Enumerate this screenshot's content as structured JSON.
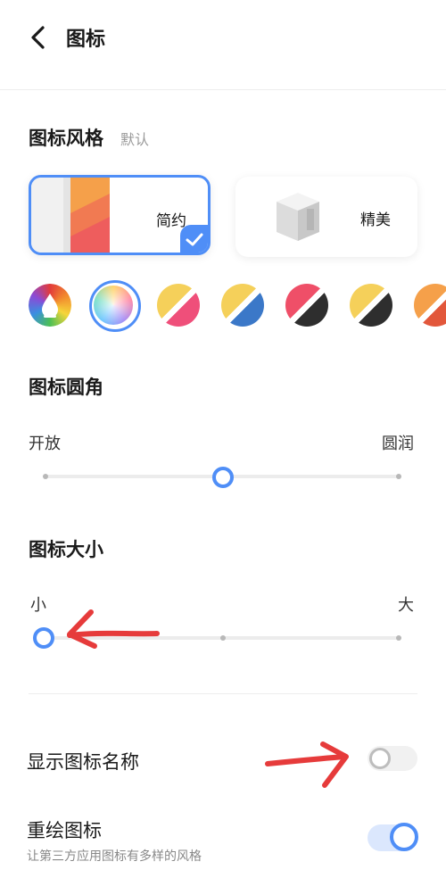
{
  "header": {
    "title": "图标"
  },
  "icon_style": {
    "title": "图标风格",
    "subtitle": "默认",
    "options": [
      {
        "label": "简约",
        "selected": true
      },
      {
        "label": "精美",
        "selected": false
      }
    ]
  },
  "color_themes": {
    "selected_index": 1,
    "swatches": [
      {
        "name": "rainbow-drop"
      },
      {
        "name": "pastel-gradient"
      },
      {
        "name": "pink-yellow"
      },
      {
        "name": "blue-yellow"
      },
      {
        "name": "black-red"
      },
      {
        "name": "black-yellow"
      },
      {
        "name": "orange-red"
      }
    ]
  },
  "corner": {
    "title": "图标圆角",
    "min_label": "开放",
    "max_label": "圆润",
    "steps": 3,
    "value_index": 1
  },
  "size": {
    "title": "图标大小",
    "min_label": "小",
    "max_label": "大",
    "steps": 3,
    "value_index": 0
  },
  "show_name": {
    "label": "显示图标名称",
    "enabled": false
  },
  "redraw": {
    "label": "重绘图标",
    "description": "让第三方应用图标有多样的风格",
    "enabled": true
  },
  "colors": {
    "accent": "#4f8ef7",
    "annotation": "#e63b3b"
  }
}
